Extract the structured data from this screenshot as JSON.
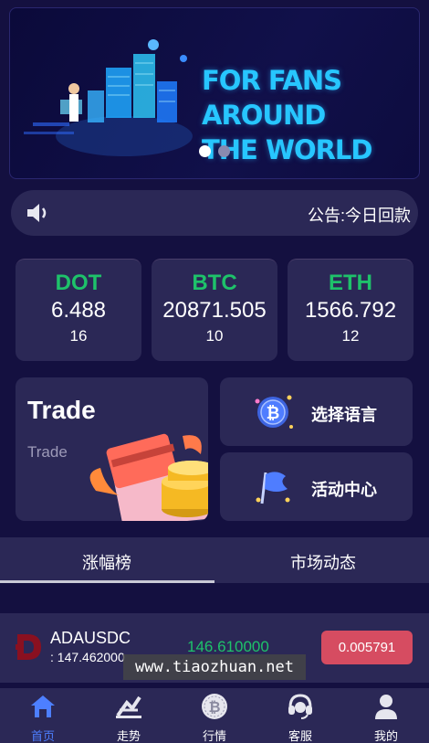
{
  "banner": {
    "line1": "FOR FANS AROUND",
    "line2": "THE WORLD",
    "slide_count": 2,
    "active_slide": 0
  },
  "notice": {
    "text": "公告:今日回款"
  },
  "coins": [
    {
      "symbol": "DOT",
      "price": "6.488",
      "change": "16"
    },
    {
      "symbol": "BTC",
      "price": "20871.505",
      "change": "10"
    },
    {
      "symbol": "ETH",
      "price": "1566.792",
      "change": "12"
    }
  ],
  "trade_card": {
    "title": "Trade",
    "subtitle": "Trade"
  },
  "side_cards": {
    "language": "选择语言",
    "activity": "活动中心"
  },
  "tabs": [
    {
      "label": "涨幅榜",
      "active": true
    },
    {
      "label": "市场动态",
      "active": false
    }
  ],
  "market_rows": [
    {
      "pair": "ADAUSDC",
      "volume": ": 147.462000",
      "price": "146.610000",
      "change": "0.005791"
    }
  ],
  "watermark": "www.tiaozhuan.net",
  "nav": [
    {
      "label": "首页",
      "icon": "home-icon",
      "active": true
    },
    {
      "label": "走势",
      "icon": "trend-icon",
      "active": false
    },
    {
      "label": "行情",
      "icon": "bitcoin-coin-icon",
      "active": false
    },
    {
      "label": "客服",
      "icon": "headset-icon",
      "active": false
    },
    {
      "label": "我的",
      "icon": "user-icon",
      "active": false
    }
  ],
  "colors": {
    "background": "#141040",
    "card": "#2b2856",
    "up_green": "#1ec26a",
    "down_red": "#d64c61",
    "nav_active": "#4d7fff",
    "banner_text": "#27c6ff"
  }
}
